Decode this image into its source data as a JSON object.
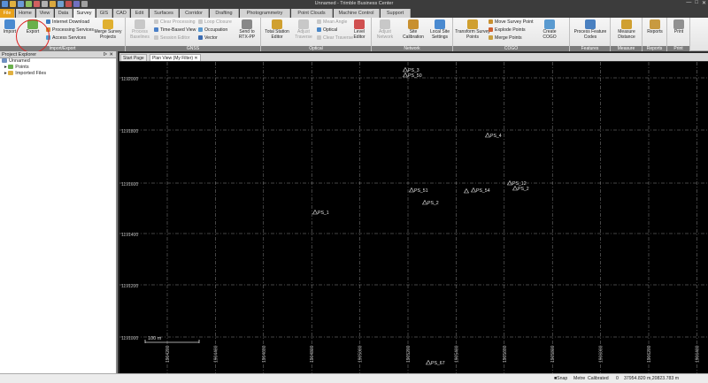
{
  "window": {
    "title": "Unnamed - Trimble Business Center",
    "controls": [
      "—",
      "□",
      "✕"
    ]
  },
  "tabs": [
    {
      "label": "File",
      "w": 17
    },
    {
      "label": "Home",
      "w": 22
    },
    {
      "label": "View",
      "w": 20
    },
    {
      "label": "Data",
      "w": 20
    },
    {
      "label": "Survey",
      "w": 25
    },
    {
      "label": "GIS",
      "w": 18
    },
    {
      "label": "CAD",
      "w": 19
    },
    {
      "label": "Edit",
      "w": 20
    },
    {
      "label": "Surfaces",
      "w": 33
    },
    {
      "label": "Corridor",
      "w": 33
    },
    {
      "label": "Drafting",
      "w": 33
    },
    {
      "label": "Photogrammetry",
      "w": 57
    },
    {
      "label": "Point Clouds",
      "w": 47
    },
    {
      "label": "Machine Control",
      "w": 52
    },
    {
      "label": "Support",
      "w": 34
    }
  ],
  "ribbon": {
    "groups": [
      "Import/Export",
      "GNSS",
      "Optical",
      "Network",
      "COGO",
      "Features",
      "Measure",
      "Reports",
      "Print"
    ],
    "import": "Import",
    "export": "Export",
    "internet_download": "Internet Download",
    "processing_services": "Processing Services",
    "access_services": "Access Services",
    "merge_survey_projects": "Merge Survey Projects",
    "process_baselines": "Process Baselines",
    "clear_processing": "Clear Processing",
    "time_based_view": "Time-Based View",
    "session_editor": "Session Editor",
    "loop_closure": "Loop Closure",
    "occupation": "Occupation",
    "vector": "Vector",
    "send_to_rtx": "Send to RTX-PP",
    "total_station_editor": "Total Station Editor",
    "adjust_traverse": "Adjust Traverse",
    "mean_angle": "Mean Angle",
    "optical": "Optical",
    "clear_traverse": "Clear Traverse",
    "level_editor": "Level Editor",
    "adjust_network": "Adjust Network",
    "site_calibration": "Site Calibration",
    "local_site_settings": "Local Site Settings",
    "transform_survey_points": "Transform Survey Points",
    "move_survey_point": "Move Survey Point",
    "explode_points": "Explode Points",
    "merge_points": "Merge Points",
    "create_cogo": "Create COGO",
    "process_feature_codes": "Process Feature Codes",
    "measure_distance": "Measure Distance",
    "reports": "Reports",
    "print": "Print"
  },
  "explorer": {
    "title": "Project Explorer",
    "root": "Unnamed",
    "items": [
      "Points",
      "Imported Files"
    ]
  },
  "doc_tabs": [
    "Start Page",
    "Plan View (My Filter)"
  ],
  "plan": {
    "y_labels": [
      "1192000",
      "1191800",
      "1191600",
      "1191400",
      "1191200",
      "1191000",
      "1190800"
    ],
    "x_labels": [
      "1904200",
      "1904400",
      "1904600",
      "1904800",
      "1905000",
      "1905200",
      "1905400",
      "1905600",
      "1905800",
      "1906000",
      "1906200",
      "1906400"
    ],
    "scale": "100 m",
    "points": [
      "PS_3",
      "PS_50",
      "PS_4",
      "PS_51",
      "PS_6",
      "PS_54",
      "PS_12",
      "PS_2",
      "PS_1",
      "PS_67"
    ]
  },
  "status": {
    "snap": "Snap",
    "units": "Metre",
    "calibrated": "Calibrated",
    "count": "0",
    "coords": "37954.820 m,20823.783 m"
  }
}
